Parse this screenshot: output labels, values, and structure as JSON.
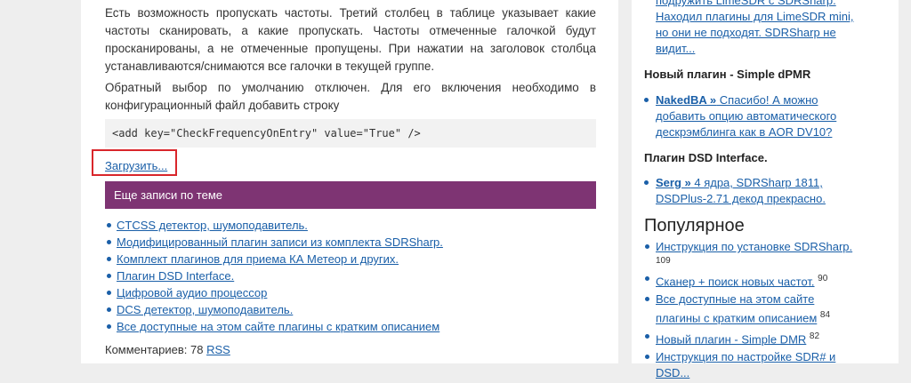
{
  "article": {
    "paragraph1": "Есть возможность пропускать частоты. Третий столбец в таблице указывает какие частоты сканировать, а какие пропускать. Частоты отмеченные галочкой будут просканированы, а не отмеченные пропущены. При нажатии на заголовок столбца устанавливаются/снимаются все галочки в текущей группе.",
    "paragraph2": "Обратный выбор по умолчанию отключен. Для его включения необходимо в конфигурационный файл добавить строку",
    "code": "<add key=\"CheckFrequencyOnEntry\" value=\"True\" />",
    "load_link": "Загрузить...",
    "related_title": "Еще записи по теме",
    "related": [
      "CTCSS детектор, шумоподавитель.",
      "Модифицированный плагин записи из комплекта SDRSharp.",
      "Комплект плагинов для приема КА Метеор и других.",
      "Плагин DSD Interface.",
      "Цифровой аудио процессор",
      "DCS детектор, шумоподавитель.",
      "Все доступные на этом сайте плагины с кратким описанием"
    ],
    "comments_label": "Комментариев: 78",
    "rss_label": "RSS"
  },
  "sidebar": {
    "top_comment_lines": [
      "подружить LimeSDR с SDRSharp.",
      "Находил плагины для LimeSDR mini,",
      "но они не подходят. SDRSharp не",
      "видит..."
    ],
    "post1_title": "Новый плагин - Simple dPMR",
    "post1_author": "NakedBA »",
    "post1_comment_lines": [
      " Спасибо! А можно",
      "добавить опцию автоматического",
      "дескрэмблинга как в AOR DV10?"
    ],
    "post2_title": "Плагин DSD Interface.",
    "post2_author": "Serg »",
    "post2_comment_lines": [
      " 4 ядра, SDRSharp 1811,",
      "DSDPlus-2.71 декод прекрасно."
    ],
    "popular_title": "Популярное",
    "popular": [
      {
        "lines": [
          "Инструкция по установке SDRSharp."
        ],
        "count": "109",
        "count_below": true
      },
      {
        "lines": [
          "Сканер + поиск новых частот."
        ],
        "count": "90",
        "count_below": false
      },
      {
        "lines": [
          "Все доступные на этом сайте",
          "плагины с кратким описанием"
        ],
        "count": "84",
        "count_below": false
      },
      {
        "lines": [
          "Новый плагин - Simple DMR"
        ],
        "count": "82",
        "count_below": false
      },
      {
        "lines": [
          "Инструкция по настройке SDR# и",
          "DSD..."
        ],
        "count": "",
        "count_below": false
      }
    ]
  }
}
